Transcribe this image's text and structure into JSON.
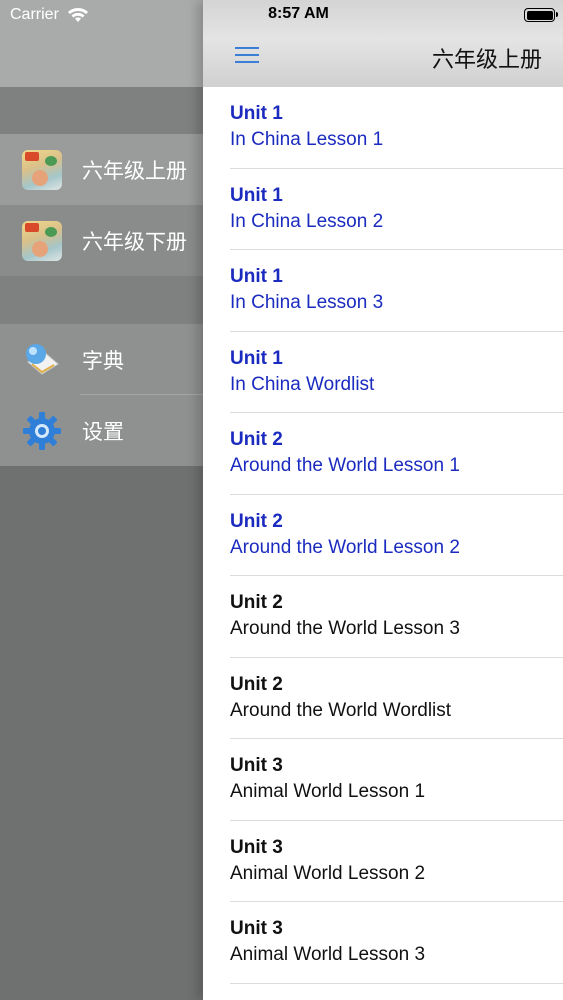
{
  "status_bar": {
    "carrier": "Carrier",
    "time": "8:57 AM"
  },
  "colors": {
    "read": "#1b2bbf",
    "unread": "#111111",
    "accent": "#3a7fd5"
  },
  "drawer": {
    "books": [
      {
        "label": "六年级上册",
        "icon": "textbook-cover-icon",
        "selected": true
      },
      {
        "label": "六年级下册",
        "icon": "textbook-cover-icon",
        "selected": false
      }
    ],
    "tools": [
      {
        "label": "字典",
        "icon": "dictionary-icon"
      },
      {
        "label": "设置",
        "icon": "gear-icon"
      }
    ]
  },
  "navbar": {
    "title": "六年级上册",
    "menu_icon": "hamburger-menu-icon"
  },
  "lessons": [
    {
      "unit": "Unit 1",
      "title": "In China Lesson 1",
      "state": "blue"
    },
    {
      "unit": "Unit 1",
      "title": "In China Lesson 2",
      "state": "blue"
    },
    {
      "unit": "Unit 1",
      "title": "In China Lesson 3",
      "state": "blue"
    },
    {
      "unit": "Unit 1",
      "title": "In China Wordlist",
      "state": "blue"
    },
    {
      "unit": "Unit 2",
      "title": "Around the World Lesson 1",
      "state": "blue"
    },
    {
      "unit": "Unit 2",
      "title": "Around the World Lesson 2",
      "state": "blue"
    },
    {
      "unit": "Unit 2",
      "title": "Around the World Lesson 3",
      "state": "black"
    },
    {
      "unit": "Unit 2",
      "title": "Around the World Wordlist",
      "state": "black"
    },
    {
      "unit": "Unit 3",
      "title": "Animal World Lesson 1",
      "state": "black"
    },
    {
      "unit": "Unit 3",
      "title": "Animal World Lesson 2",
      "state": "black"
    },
    {
      "unit": "Unit 3",
      "title": "Animal World Lesson 3",
      "state": "black"
    }
  ]
}
